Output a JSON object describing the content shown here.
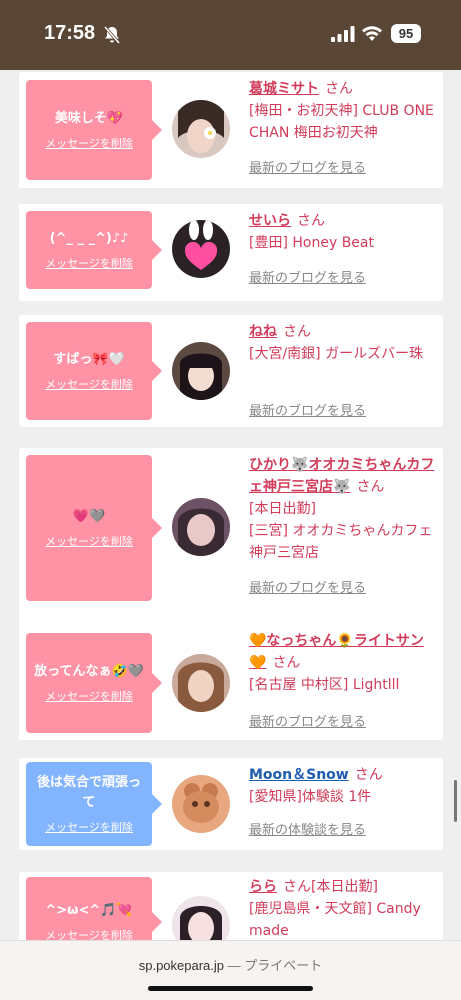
{
  "status": {
    "time": "17:58",
    "battery": "95"
  },
  "items": [
    {
      "msg": "美味しそ💖",
      "del": "メッセージを削除",
      "name": "葛城ミサト",
      "san": "さん",
      "loc": "[梅田・お初天神] CLUB ONE CHAN 梅田お初天神",
      "blog": "最新のブログを見る"
    },
    {
      "msg": "(^_ _ _^)♪♪",
      "del": "メッセージを削除",
      "name": "せいら",
      "san": "さん",
      "loc": "[豊田] Honey Beat",
      "blog": "最新のブログを見る"
    },
    {
      "msg": "すばっ🎀🤍",
      "del": "メッセージを削除",
      "name": "ねね",
      "san": "さん",
      "loc": "[大宮/南銀] ガールズバー珠",
      "blog": "最新のブログを見る"
    },
    {
      "msg": "💗🩶",
      "del": "メッセージを削除",
      "name": "ひかり🐺オオカミちゃんカフェ神戸三宮店🐺",
      "san": "さん",
      "status": "[本日出勤]",
      "loc": "[三宮] オオカミちゃんカフェ神戸三宮店",
      "blog": "最新のブログを見る"
    },
    {
      "msg": "放ってんなぁ🤣🩶",
      "del": "メッセージを削除",
      "name": "🧡なっちゃん🌻ライトサン🧡",
      "san": "さん",
      "loc": "[名古屋 中村区] Lightlll",
      "blog": "最新のブログを見る"
    },
    {
      "msg": "後は気合で頑張って",
      "del": "メッセージを削除",
      "name": "Moon＆Snow",
      "san": "さん",
      "loc": "[愛知県]体験談 1件",
      "blog": "最新の体験談を見る"
    },
    {
      "msg": "^>ω<^🎵💘",
      "del": "メッセージを削除",
      "name": "らら",
      "san": "さん",
      "status": "[本日出勤]",
      "loc": "[鹿児島県・天文館] Candy made"
    }
  ],
  "browser": {
    "url": "sp.pokepara.jp",
    "sep": " — ",
    "mode": "プライベート"
  }
}
